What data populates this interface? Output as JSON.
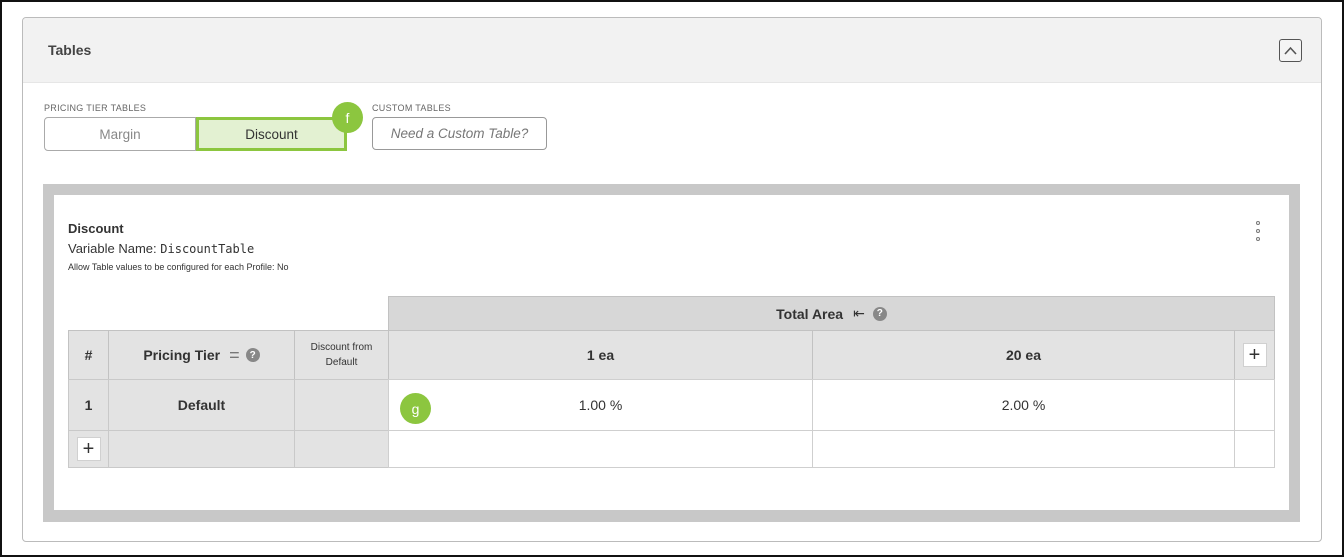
{
  "panel": {
    "title": "Tables"
  },
  "pricing_tier_tables": {
    "label": "PRICING TIER TABLES",
    "options": [
      "Margin",
      "Discount"
    ],
    "selected": "Discount"
  },
  "custom_tables": {
    "label": "CUSTOM TABLES",
    "button": "Need a Custom Table?"
  },
  "markers": {
    "f": "f",
    "g": "g"
  },
  "table": {
    "title": "Discount",
    "variable_label": "Variable Name:",
    "variable_value": "DiscountTable",
    "allow_label": "Allow Table values to be configured for each Profile:",
    "allow_value": "No",
    "header": {
      "total_area": "Total Area",
      "total_area_icon": "⇤",
      "num": "#",
      "pricing_tier": "Pricing Tier",
      "pricing_tier_icon": "=",
      "discount_from_default": "Discount from Default",
      "columns": [
        "1  ea",
        "20  ea"
      ],
      "add_column": "+"
    },
    "rows": [
      {
        "num": "1",
        "tier": "Default",
        "values": [
          "1.00 %",
          "2.00 %"
        ]
      }
    ],
    "add_row": "+",
    "help_icon": "?"
  },
  "colors": {
    "accent_green": "#8cc63f",
    "selected_bg": "#e3f1d2",
    "frame_gray": "#c8c8c8"
  }
}
